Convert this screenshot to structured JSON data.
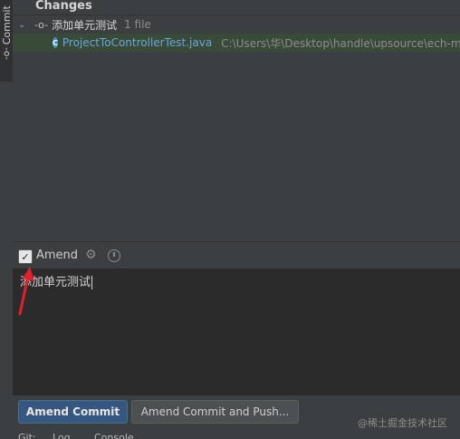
{
  "sidebar": {
    "tab_label": "Commit",
    "tab_icon": "commit-icon"
  },
  "changes": {
    "title": "Changes",
    "group": {
      "name": "添加单元测试",
      "count": "1 file"
    },
    "file": {
      "icon_letter": "C",
      "name": "ProjectToControllerTest.java",
      "path": "C:\\Users\\华\\Desktop\\handle\\upsource\\ech-m"
    }
  },
  "amend": {
    "checked": true,
    "label": "Amend"
  },
  "commit_message": "添加单元测试",
  "buttons": {
    "amend_commit": "Amend Commit",
    "amend_commit_push": "Amend Commit and Push..."
  },
  "watermark": "@稀土掘金技术社区",
  "bottom_tabs": [
    "Git:",
    "Log",
    "Console"
  ],
  "colors": {
    "accent": "#365880",
    "file_link": "#6aa6da",
    "arrow": "#e0202a"
  }
}
